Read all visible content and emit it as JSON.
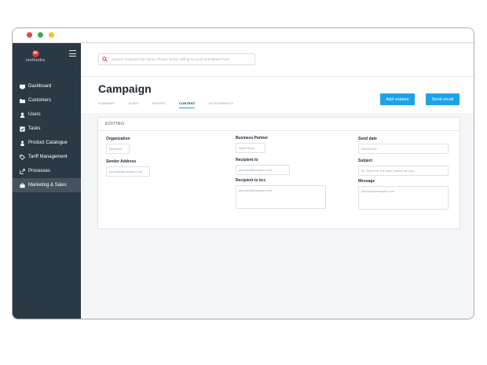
{
  "brand": {
    "name": "methodia",
    "mark": "m",
    "accent": "#d6333b"
  },
  "search": {
    "placeholder": "Search customers by Name, Phone, Email, Billing Account and Meter Point"
  },
  "sidebar": {
    "items": [
      {
        "label": "Dashboard",
        "icon": "dashboard-icon"
      },
      {
        "label": "Customers",
        "icon": "folder-icon"
      },
      {
        "label": "Users",
        "icon": "user-icon"
      },
      {
        "label": "Tasks",
        "icon": "checkbox-icon"
      },
      {
        "label": "Product Catalogue",
        "icon": "product-icon"
      },
      {
        "label": "Tariff Management",
        "icon": "tag-icon"
      },
      {
        "label": "Processes",
        "icon": "share-icon"
      },
      {
        "label": "Marketing & Sales",
        "icon": "briefcase-icon",
        "active": true
      }
    ]
  },
  "page": {
    "title": "Campaign",
    "tabs": [
      {
        "label": "SUMMARY"
      },
      {
        "label": "AUDIT"
      },
      {
        "label": "INVITES"
      },
      {
        "label": "CONTENT",
        "active": true
      },
      {
        "label": "ATTACHMENTS"
      }
    ],
    "add_estates_label": "Add estates",
    "send_email_label": "Send email"
  },
  "editing": {
    "header": "EDITING",
    "organization": {
      "label": "Organization",
      "value": "Methodia"
    },
    "sender_address": {
      "label": "Sender Address",
      "value": "johndoe@example.com"
    },
    "business_partner": {
      "label": "Business Partner",
      "value": "Nose Reny"
    },
    "recipient_to": {
      "label": "Recipient to",
      "value": "johndoe@example.com"
    },
    "recipient_bcc": {
      "label": "Recipient to bcc",
      "value": "johndoe@example.com"
    },
    "send_date": {
      "label": "Send date",
      "value": "09/09/2021"
    },
    "subject": {
      "label": "Subject",
      "value": "It's Time For The New Season at Gas"
    },
    "message": {
      "label": "Message",
      "value": "johndoe@example.com"
    }
  },
  "colors": {
    "sidebar": "#2b3944",
    "sidebar_active": "#46535e",
    "primary_button": "#1aa3ea",
    "tab_underline": "#1a9ee0"
  }
}
